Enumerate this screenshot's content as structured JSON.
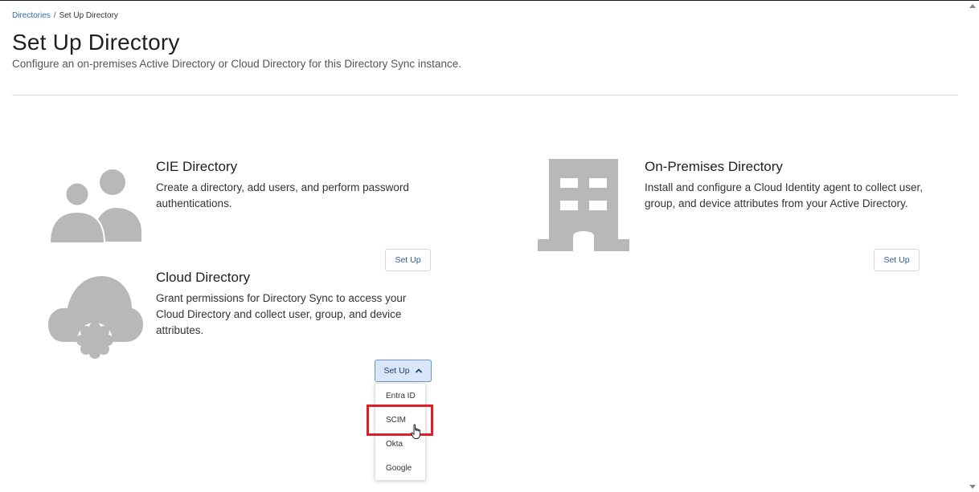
{
  "breadcrumb": {
    "parent": "Directories",
    "separator": "/",
    "current": "Set Up Directory"
  },
  "header": {
    "title": "Set Up Directory",
    "subtitle": "Configure an on-premises Active Directory or Cloud Directory for this Directory Sync instance."
  },
  "cards": {
    "cie": {
      "icon": "users-icon",
      "title": "CIE Directory",
      "description": "Create a directory, add users, and perform password authentications.",
      "button_label": "Set Up"
    },
    "on_prem": {
      "icon": "building-icon",
      "title": "On-Premises Directory",
      "description": "Install and configure a Cloud Identity agent to collect user, group, and device attributes from your Active Directory.",
      "button_label": "Set Up"
    },
    "cloud": {
      "icon": "cloud-gear-icon",
      "title": "Cloud Directory",
      "description": "Grant permissions for Directory Sync to access your Cloud Directory and collect user, group, and device attributes.",
      "button_label": "Set Up"
    }
  },
  "dropdown": {
    "items": [
      "Entra ID",
      "SCIM",
      "Okta",
      "Google"
    ],
    "highlighted": "SCIM"
  },
  "colors": {
    "link": "#2e6fb0",
    "icon_gray": "#b8b8b8",
    "highlight": "#e01c24",
    "button_open_bg": "#d9e6f7"
  }
}
